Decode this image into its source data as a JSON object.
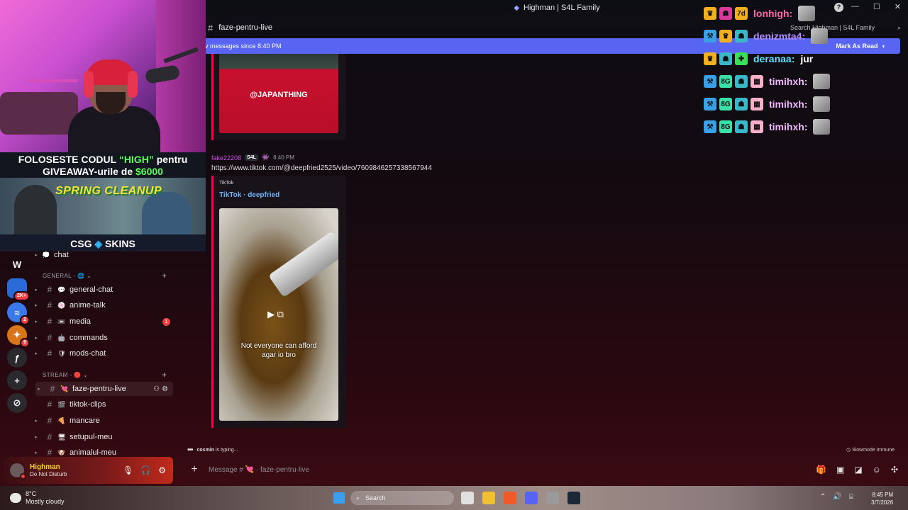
{
  "window": {
    "title": "Highman | S4L Family",
    "controls": [
      "—",
      "☐",
      "✕"
    ]
  },
  "header": {
    "channel": "faze-pentru-live",
    "search_placeholder": "Search Highman | S4L Family"
  },
  "banner": {
    "text": "v messages since 8:40 PM",
    "action": "Mark As Read"
  },
  "stream_overlay": {
    "promo_line1_pre": "FOLOSESTE CODUL ",
    "promo_code": "“HIGH”",
    "promo_line1_post": " pentru",
    "promo_line2_pre": "GIVEAWAY-urile de ",
    "promo_amount": "$6000",
    "spring_label": "SPRING CLEANUP",
    "sponsor_left": "CSG",
    "sponsor_right": "SKINS"
  },
  "sidebar": {
    "partial_channel": {
      "label": "chat",
      "emoji": "💭"
    },
    "categories": [
      {
        "name": "GENERAL - 🌐 ⌄",
        "plus": "+"
      },
      {
        "name": "STREAM - 🔴 ⌄",
        "plus": "+"
      }
    ],
    "general_channels": [
      {
        "label": "general-chat",
        "emoji": "💬",
        "badge": ""
      },
      {
        "label": "anime-talk",
        "emoji": "🍥",
        "badge": ""
      },
      {
        "label": "media",
        "emoji": "📼",
        "badge": "1"
      },
      {
        "label": "commands",
        "emoji": "🤖",
        "badge": ""
      },
      {
        "label": "mods-chat",
        "emoji": "🛡",
        "badge": ""
      }
    ],
    "stream_channels": [
      {
        "label": "faze-pentru-live",
        "emoji": "💘",
        "active": true
      },
      {
        "label": "tiktok-clips",
        "emoji": "🎬"
      },
      {
        "label": "mancare",
        "emoji": "🍕"
      },
      {
        "label": "setupul-meu",
        "emoji": "🖥"
      },
      {
        "label": "animalul-meu",
        "emoji": "🐶"
      }
    ],
    "rail_badges": [
      "2K+",
      "2",
      "9"
    ]
  },
  "user_panel": {
    "name": "Highman",
    "status": "Do Not Disturb"
  },
  "messages": {
    "top_embed_handle": "@JAPANTHING",
    "author": "fake22208",
    "author_tag": "S4L",
    "time": "8:40 PM",
    "link": "https://www.tiktok.com/@deepfried2525/video/7609846257338567944",
    "embed_provider": "TikTok",
    "embed_title": "TikTok · deepfried",
    "video_caption_1": "Not everyone can afford",
    "video_caption_2": "agar io bro",
    "typing_user": "cosmin",
    "typing_suffix": " is typing...",
    "slowmode": "Slowmode Immune"
  },
  "composer": {
    "placeholder_pre": "Message #",
    "placeholder_channel": "faze-pentru-live"
  },
  "overlay_chat": [
    {
      "name": "lonhigh:",
      "color": "#ff66aa",
      "msg": ""
    },
    {
      "name": "denizmta4:",
      "color": "#b48cff",
      "msg": ""
    },
    {
      "name": "deranaa:",
      "color": "#5ee0ff",
      "msg": "jur"
    },
    {
      "name": "timihxh:",
      "color": "#f2b8ff",
      "msg": ""
    },
    {
      "name": "timihxh:",
      "color": "#f2b8ff",
      "msg": ""
    },
    {
      "name": "timihxh:",
      "color": "#f2b8ff",
      "msg": ""
    }
  ],
  "taskbar": {
    "temp": "8°C",
    "weather": "Mostly cloudy",
    "search": "Search",
    "time": "8:45 PM",
    "date": "3/7/2026"
  }
}
